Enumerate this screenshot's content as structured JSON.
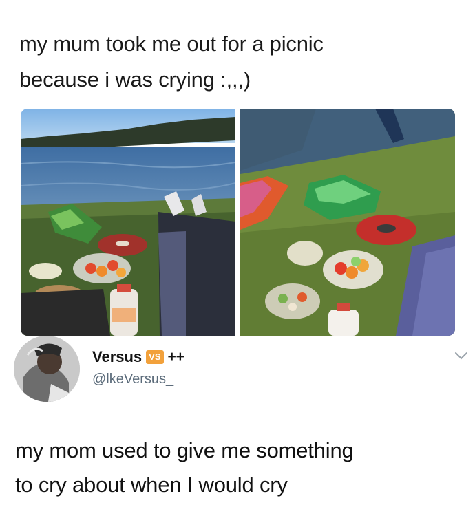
{
  "post": {
    "caption_line1": "my mum took me out for a picnic",
    "caption_line2": "because i was crying :,,,)"
  },
  "images": [
    {
      "subject": "picnic-by-lake-left"
    },
    {
      "subject": "picnic-on-grass-right"
    }
  ],
  "tweet": {
    "display_name": "Versus",
    "badge": "VS",
    "badge_color": "#f2a13b",
    "suffix": "++",
    "handle": "@lkeVersus_",
    "body_line1": "my mom used to give me something",
    "body_line2": "to cry about when I would cry"
  },
  "colors": {
    "text": "#111111",
    "handle": "#5b6b7a",
    "background": "#ffffff"
  }
}
